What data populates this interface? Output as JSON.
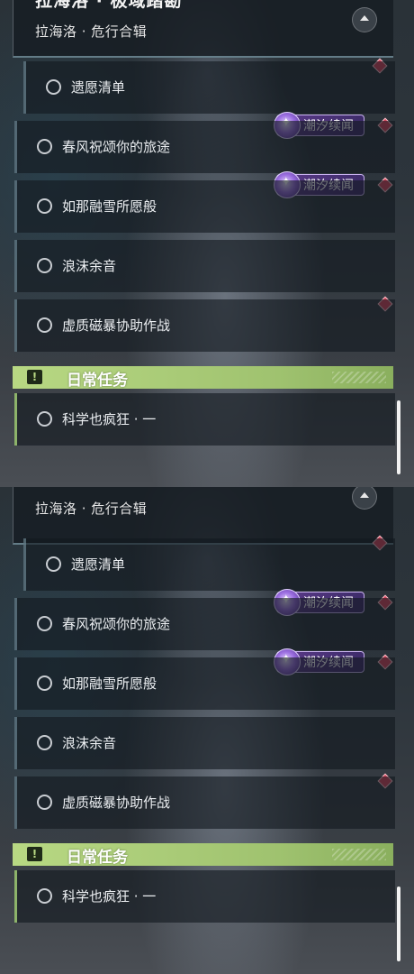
{
  "region": {
    "title": "拉海洛 · 极域踏勘",
    "subtitle": "拉海洛 · 危行合辑"
  },
  "quests": [
    {
      "label": "遗愿清单"
    },
    {
      "label": "春风祝颂你的旅途",
      "badge": "潮汐续闻"
    },
    {
      "label": "如那融雪所愿般",
      "badge": "潮汐续闻"
    },
    {
      "label": "浪沫余音"
    },
    {
      "label": "虚质磁暴协助作战"
    }
  ],
  "daily": {
    "title": "日常任务",
    "icon": "!",
    "quests": [
      {
        "label": "科学也疯狂 · 一"
      }
    ]
  },
  "colors": {
    "daily_accent": "#b8d883",
    "tracker_marker": "#d9465c",
    "tide_badge": "#5c3b8a"
  },
  "icons": [
    "collapse-arrow-icon",
    "quest-circle-icon",
    "tracker-diamond-icon",
    "tide-badge-icon",
    "daily-alert-icon"
  ]
}
